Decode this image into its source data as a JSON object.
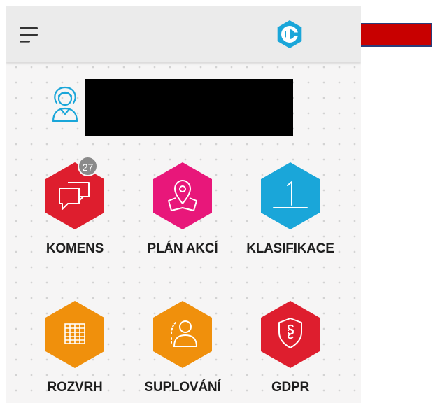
{
  "header": {
    "menu_icon": "hamburger-menu-icon",
    "logo_icon": "bakalari-logo-icon",
    "logo_color": "#1aa6d9"
  },
  "profile": {
    "avatar_icon": "user-avatar-icon",
    "name_redacted": true
  },
  "tiles": [
    {
      "id": "komens",
      "label": "KOMENS",
      "icon": "chat-bubbles-icon",
      "color": "#de1e2e",
      "badge": "27"
    },
    {
      "id": "plan-akci",
      "label": "PLÁN AKCÍ",
      "icon": "map-pin-icon",
      "color": "#e8177a"
    },
    {
      "id": "klasifikace",
      "label": "KLASIFIKACE",
      "icon": "grade-one-icon",
      "color": "#1aa6d9"
    },
    {
      "id": "rozvrh",
      "label": "ROZVRH",
      "icon": "timetable-grid-icon",
      "color": "#f0900c"
    },
    {
      "id": "suplovani",
      "label": "SUPLOVÁNÍ",
      "icon": "substitute-person-icon",
      "color": "#f0900c"
    },
    {
      "id": "gdpr",
      "label": "GDPR",
      "icon": "shield-paragraph-icon",
      "color": "#de1e2e"
    }
  ],
  "annotation": {
    "arrow_icon": "red-arrow-icon",
    "arrow_color": "#c80000"
  }
}
